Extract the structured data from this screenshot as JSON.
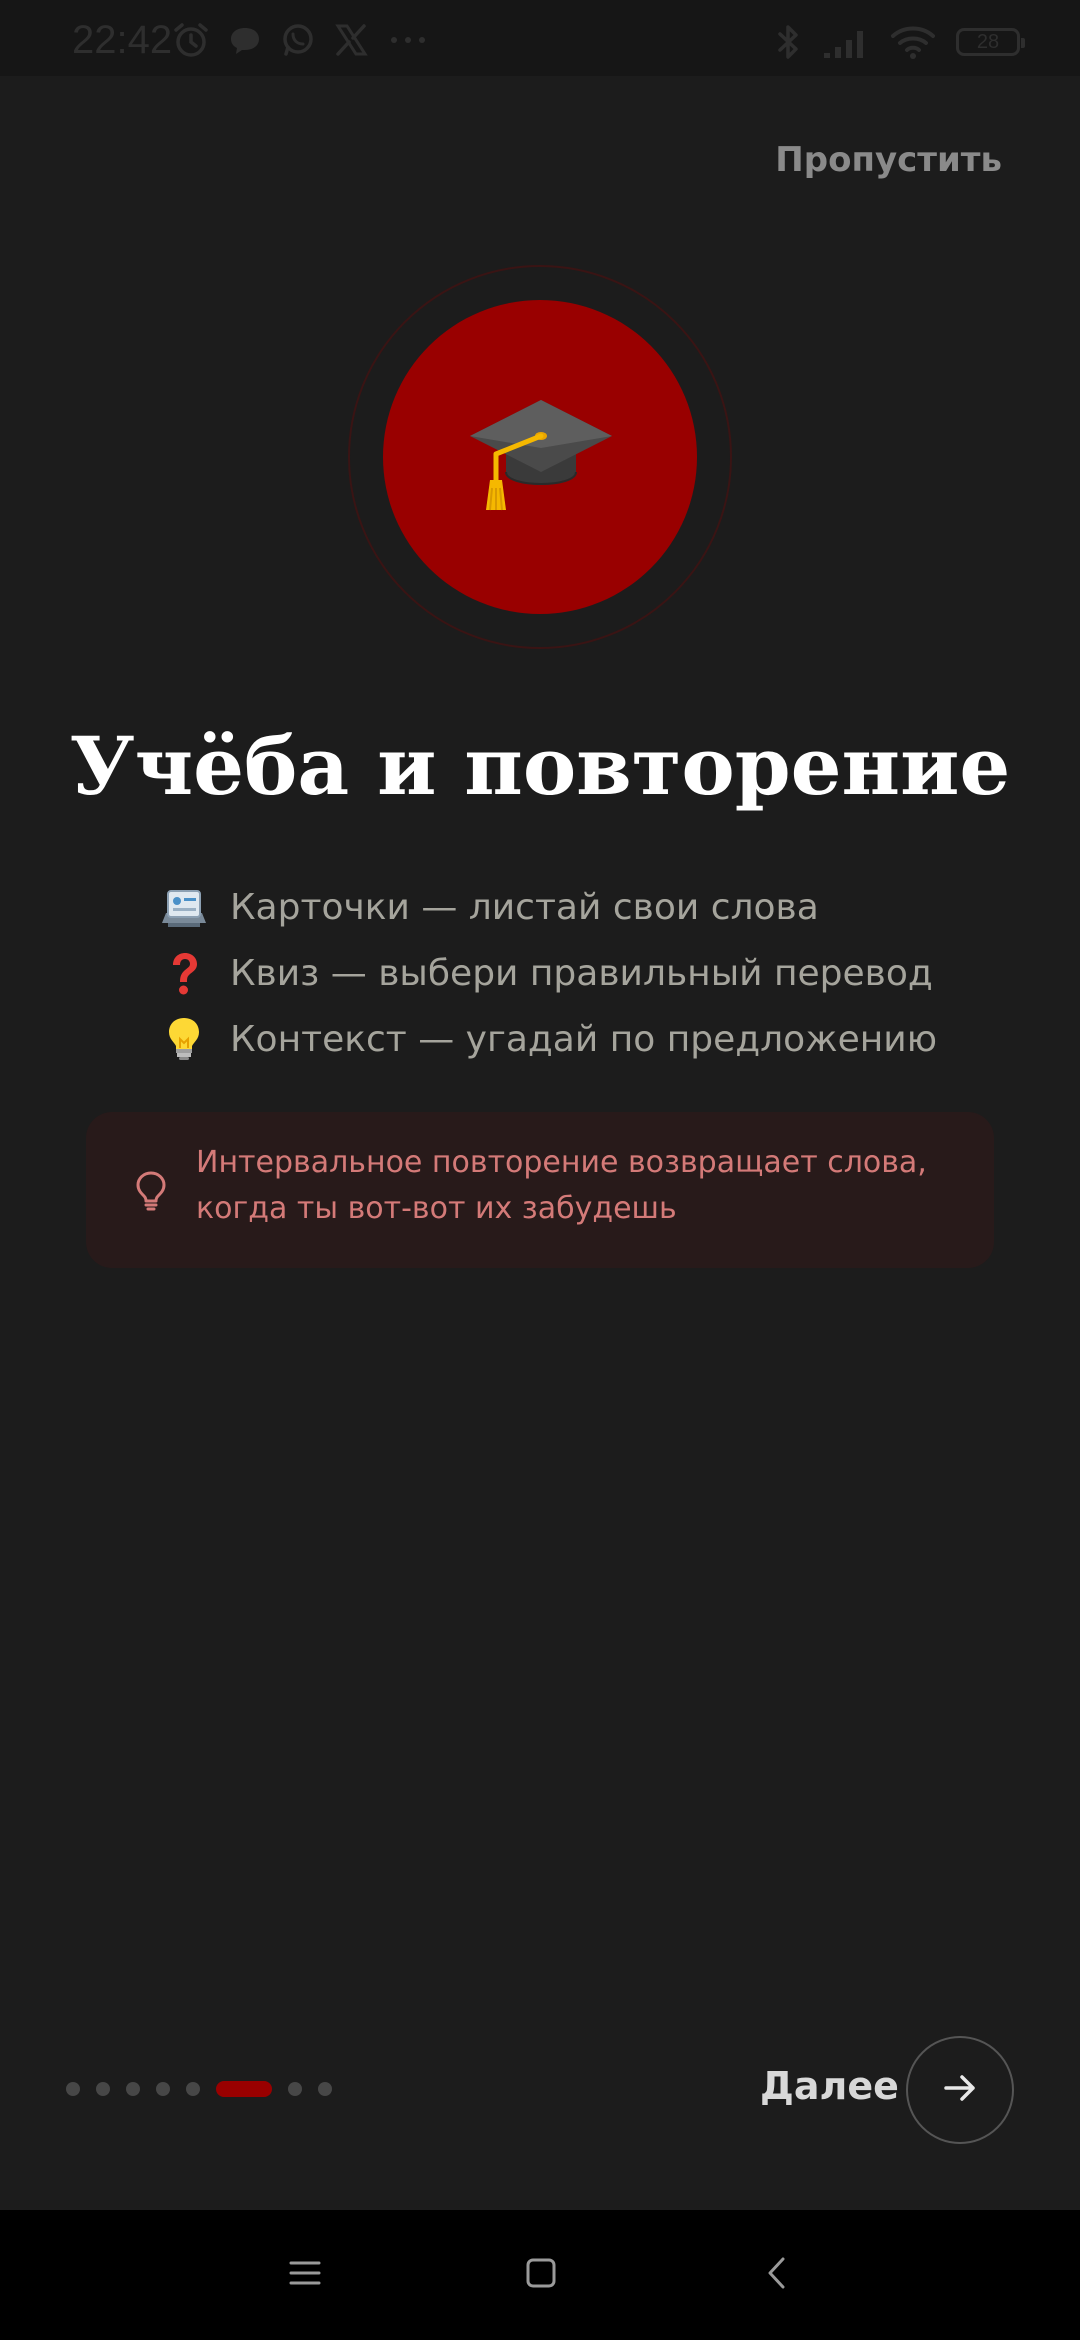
{
  "status_bar": {
    "time": "22:42",
    "battery": "28",
    "more": "···"
  },
  "header": {
    "skip_label": "Пропустить"
  },
  "hero": {
    "icon": "graduation-cap-icon",
    "circle_color": "#990000"
  },
  "main": {
    "title": "Учёба и повторение",
    "features": [
      {
        "icon": "card-index-icon",
        "text": "Карточки — листай свои слова"
      },
      {
        "icon": "question-mark-icon",
        "text": "Квиз — выбери правильный перевод"
      },
      {
        "icon": "light-bulb-icon",
        "text": "Контекст — угадай по предложению"
      }
    ],
    "tip": {
      "icon": "lightbulb-outline-icon",
      "text": "Интервальное повторение возвращает слова, когда ты вот-вот их забудешь"
    }
  },
  "footer": {
    "pagination": {
      "total": 8,
      "current": 6
    },
    "next_label": "Далее",
    "next_icon": "arrow-right-icon"
  },
  "colors": {
    "accent": "#990000",
    "background": "#1c1c1c",
    "tip_text": "#d47a78"
  }
}
